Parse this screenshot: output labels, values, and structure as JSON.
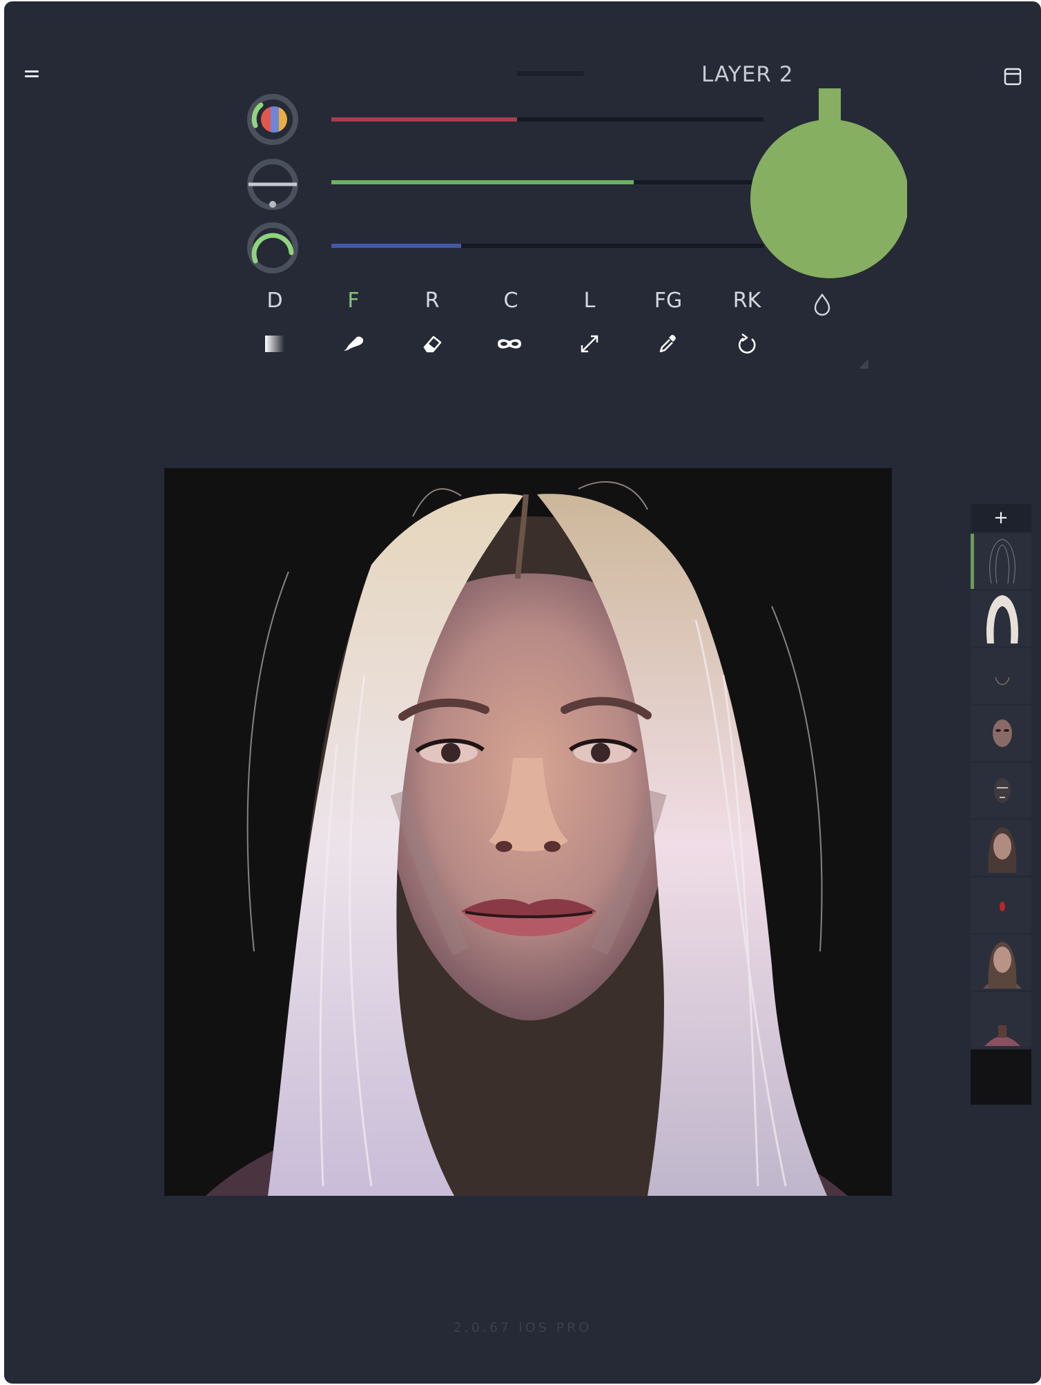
{
  "header": {
    "layer_title": "LAYER 2"
  },
  "sliders": [
    {
      "name": "hue",
      "level": 0.43,
      "color": "#a3404f"
    },
    {
      "name": "saturation",
      "level": 0.7,
      "color": "#6bb35f"
    },
    {
      "name": "brightness",
      "level": 0.3,
      "color": "#4358a6"
    }
  ],
  "current_color": "#86af62",
  "tools": [
    {
      "letter": "D",
      "icon": "gradient-icon"
    },
    {
      "letter": "F",
      "icon": "brush-icon",
      "active": true
    },
    {
      "letter": "R",
      "icon": "eraser-icon"
    },
    {
      "letter": "C",
      "icon": "mask-icon"
    },
    {
      "letter": "L",
      "icon": "expand-icon"
    },
    {
      "letter": "FG",
      "icon": "eyedropper-icon"
    },
    {
      "letter": "RK",
      "icon": "undo-icon"
    }
  ],
  "opacity_icon": "drop-icon",
  "layers": {
    "add_label": "+",
    "count": 10,
    "active_index": 0
  },
  "footer": {
    "version": "2.0.67 IOS PRO"
  },
  "colors": {
    "app_bg": "#252a36",
    "accent_green": "#89c37a"
  }
}
